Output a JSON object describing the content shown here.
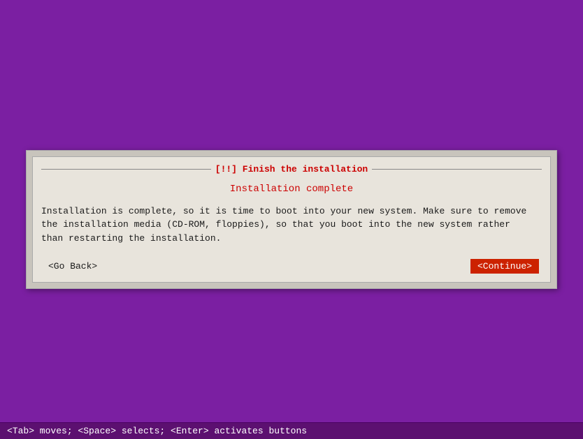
{
  "background_color": "#7B1FA2",
  "dialog": {
    "title": "[!!] Finish the installation",
    "subtitle": "Installation complete",
    "body_text": "Installation is complete, so it is time to boot into your new system. Make sure to remove\nthe installation media (CD-ROM, floppies), so that you boot into the new system rather\nthan restarting the installation.",
    "btn_go_back": "<Go Back>",
    "btn_continue": "<Continue>"
  },
  "status_bar": {
    "text": "<Tab> moves; <Space> selects; <Enter> activates buttons"
  }
}
